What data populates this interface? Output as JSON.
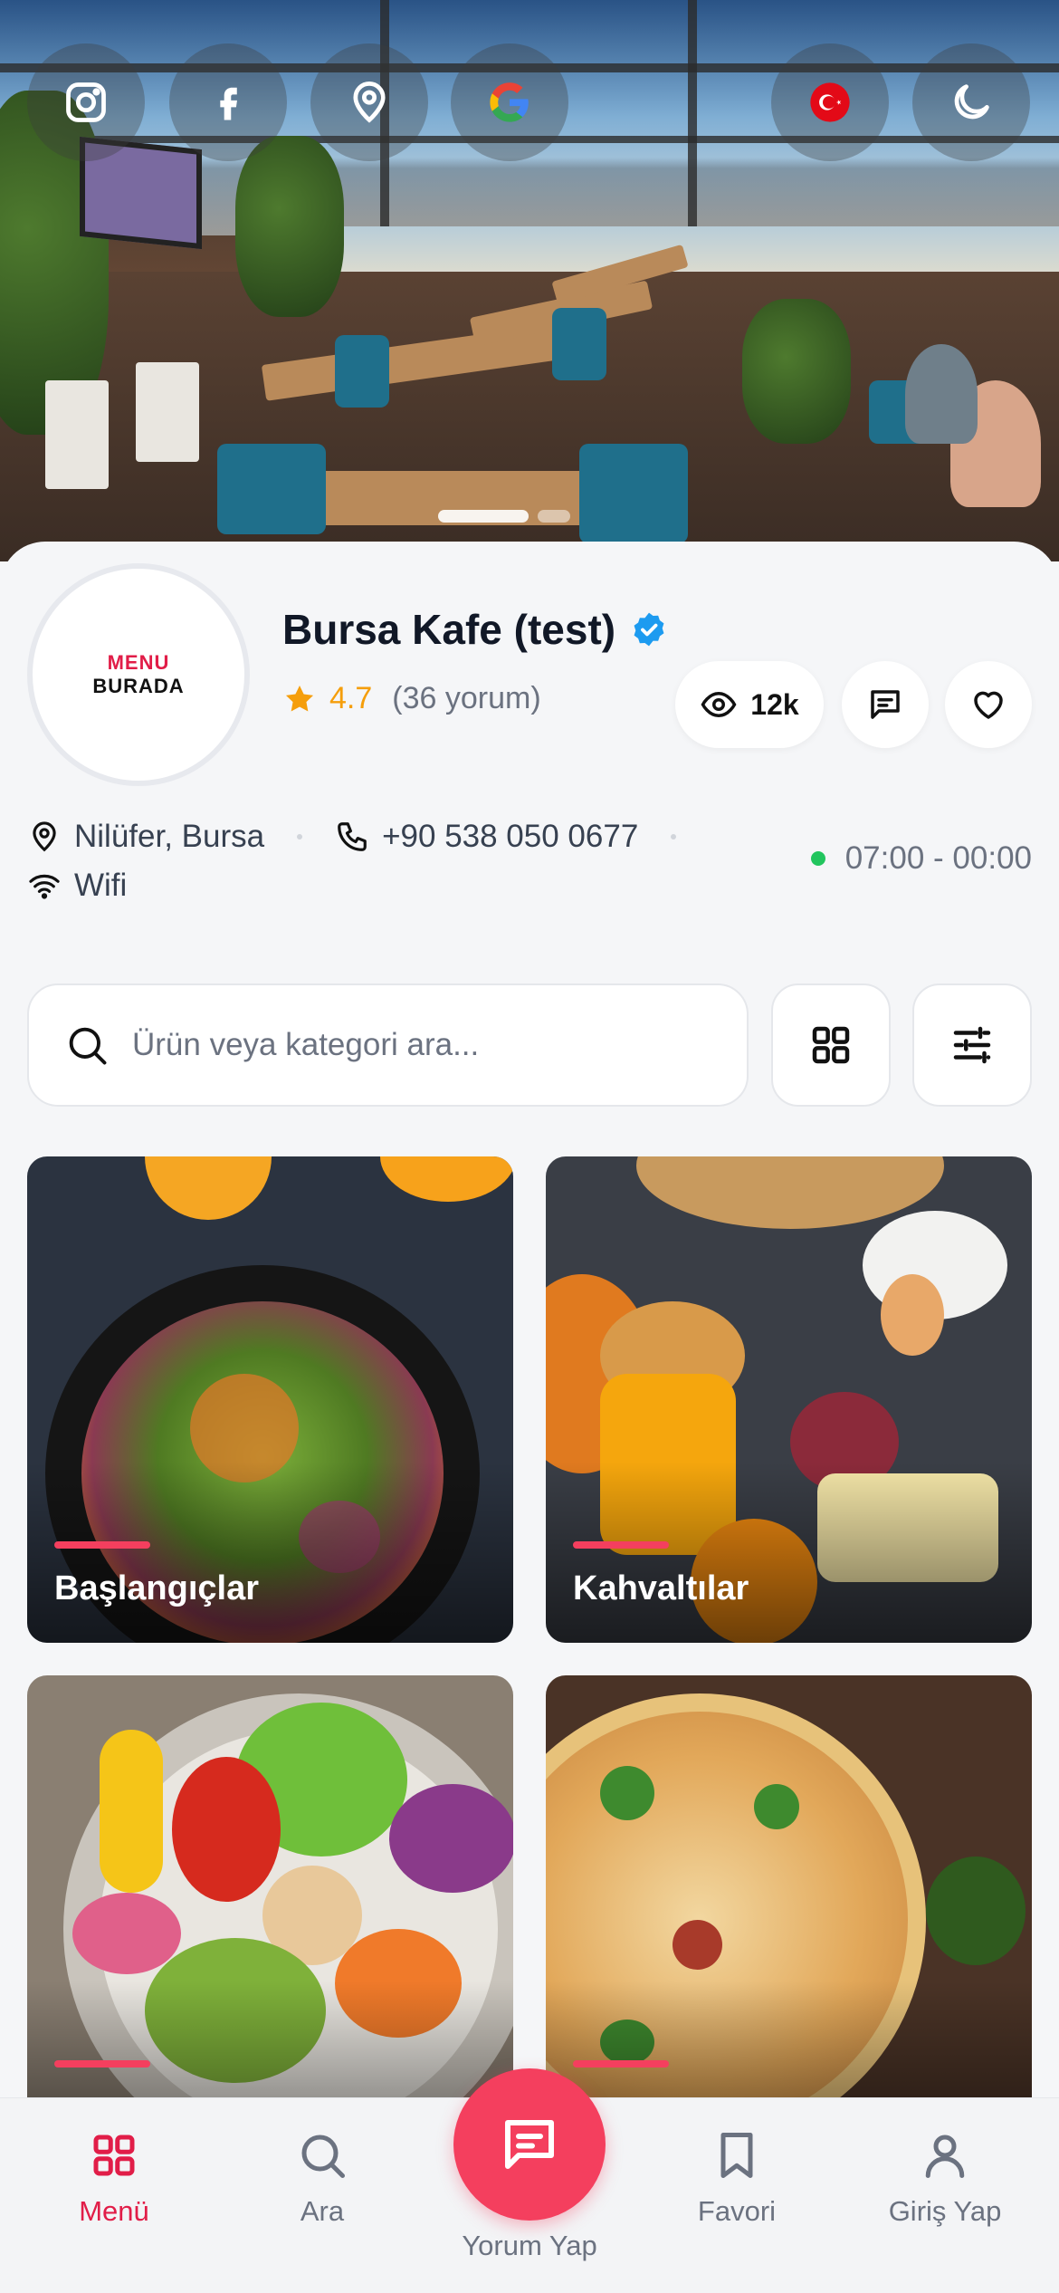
{
  "header": {
    "social": [
      "instagram-icon",
      "facebook-icon",
      "location-pin-icon",
      "google-icon"
    ],
    "language_flag": "turkey-flag-icon",
    "theme_toggle": "moon-icon"
  },
  "restaurant": {
    "logo_line1": "MENU",
    "logo_line2": "BURADA",
    "name": "Bursa Kafe (test)",
    "rating": "4.7",
    "reviews": "(36 yorum)",
    "views": "12k",
    "location": "Nilüfer, Bursa",
    "phone": "+90 538 050 0677",
    "wifi": "Wifi",
    "hours": "07:00 - 00:00"
  },
  "search": {
    "placeholder": "Ürün veya kategori ara..."
  },
  "categories": [
    {
      "label": "Başlangıçlar"
    },
    {
      "label": "Kahvaltılar"
    },
    {
      "label": ""
    },
    {
      "label": ""
    }
  ],
  "nav": {
    "menu": "Menü",
    "search": "Ara",
    "review": "Yorum Yap",
    "favorites": "Favori",
    "login": "Giriş Yap"
  },
  "colors": {
    "accent": "#f43f5e",
    "active": "#e11d48",
    "star": "#f59e0b",
    "verified": "#1d9bf0",
    "open": "#22c55e"
  }
}
